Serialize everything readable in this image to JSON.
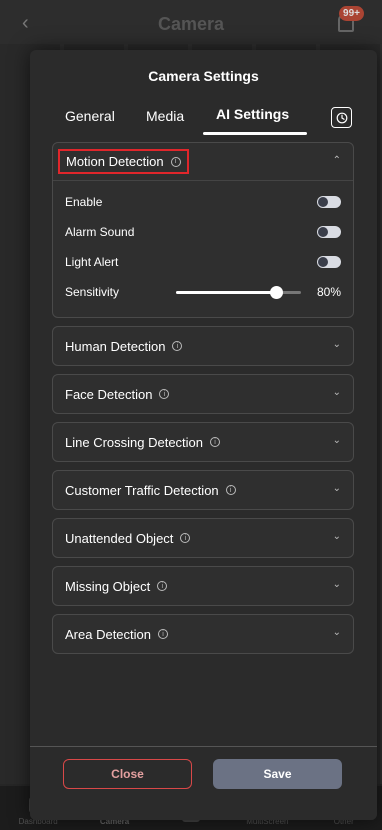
{
  "background": {
    "title": "Camera",
    "badge": "99+",
    "nav": [
      "Dashboard",
      "Camera",
      "",
      "MultiScreen",
      "Other"
    ]
  },
  "modal": {
    "title": "Camera Settings",
    "tabs": {
      "general": "General",
      "media": "Media",
      "ai": "AI Settings"
    },
    "active_tab": "AI Settings"
  },
  "motion": {
    "label": "Motion Detection",
    "rows": {
      "enable": "Enable",
      "alarm": "Alarm Sound",
      "light": "Light Alert",
      "sensitivity": "Sensitivity"
    },
    "sensitivity_value": 80,
    "sensitivity_text": "80%"
  },
  "panels": [
    "Human Detection",
    "Face Detection",
    "Line Crossing Detection",
    "Customer Traffic Detection",
    "Unattended Object",
    "Missing Object",
    "Area Detection"
  ],
  "footer": {
    "close": "Close",
    "save": "Save"
  },
  "colors": {
    "highlight": "#e0262b",
    "save_bg": "#6b7284",
    "close_border": "#d94848"
  }
}
